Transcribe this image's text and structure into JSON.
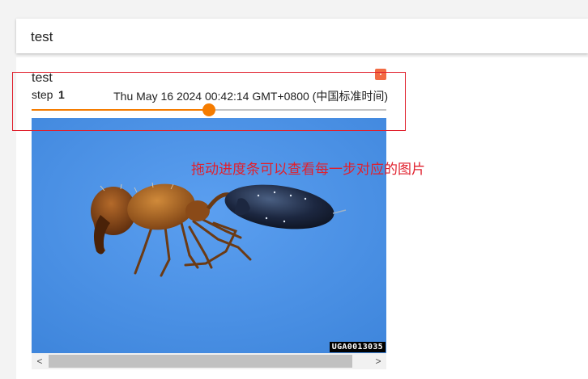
{
  "run": {
    "title": "test"
  },
  "card": {
    "title": "test",
    "step_label": "step",
    "step_value": "1",
    "timestamp": "Thu May 16 2024 00:42:14 GMT+0800 (中国标准时间)",
    "slider_fraction": 0.5,
    "image": {
      "subject": "ant-on-blue-background",
      "watermark": "UGA0013035"
    },
    "scrollbar": {
      "left_arrow": "<",
      "right_arrow": ">"
    }
  },
  "annotation": {
    "text": "拖动进度条可以查看每一步对应的图片"
  },
  "colors": {
    "accent": "#f57c00",
    "menu_button": "#f26b43",
    "annotation": "#e0202d",
    "image_background": "#4a90e2"
  }
}
